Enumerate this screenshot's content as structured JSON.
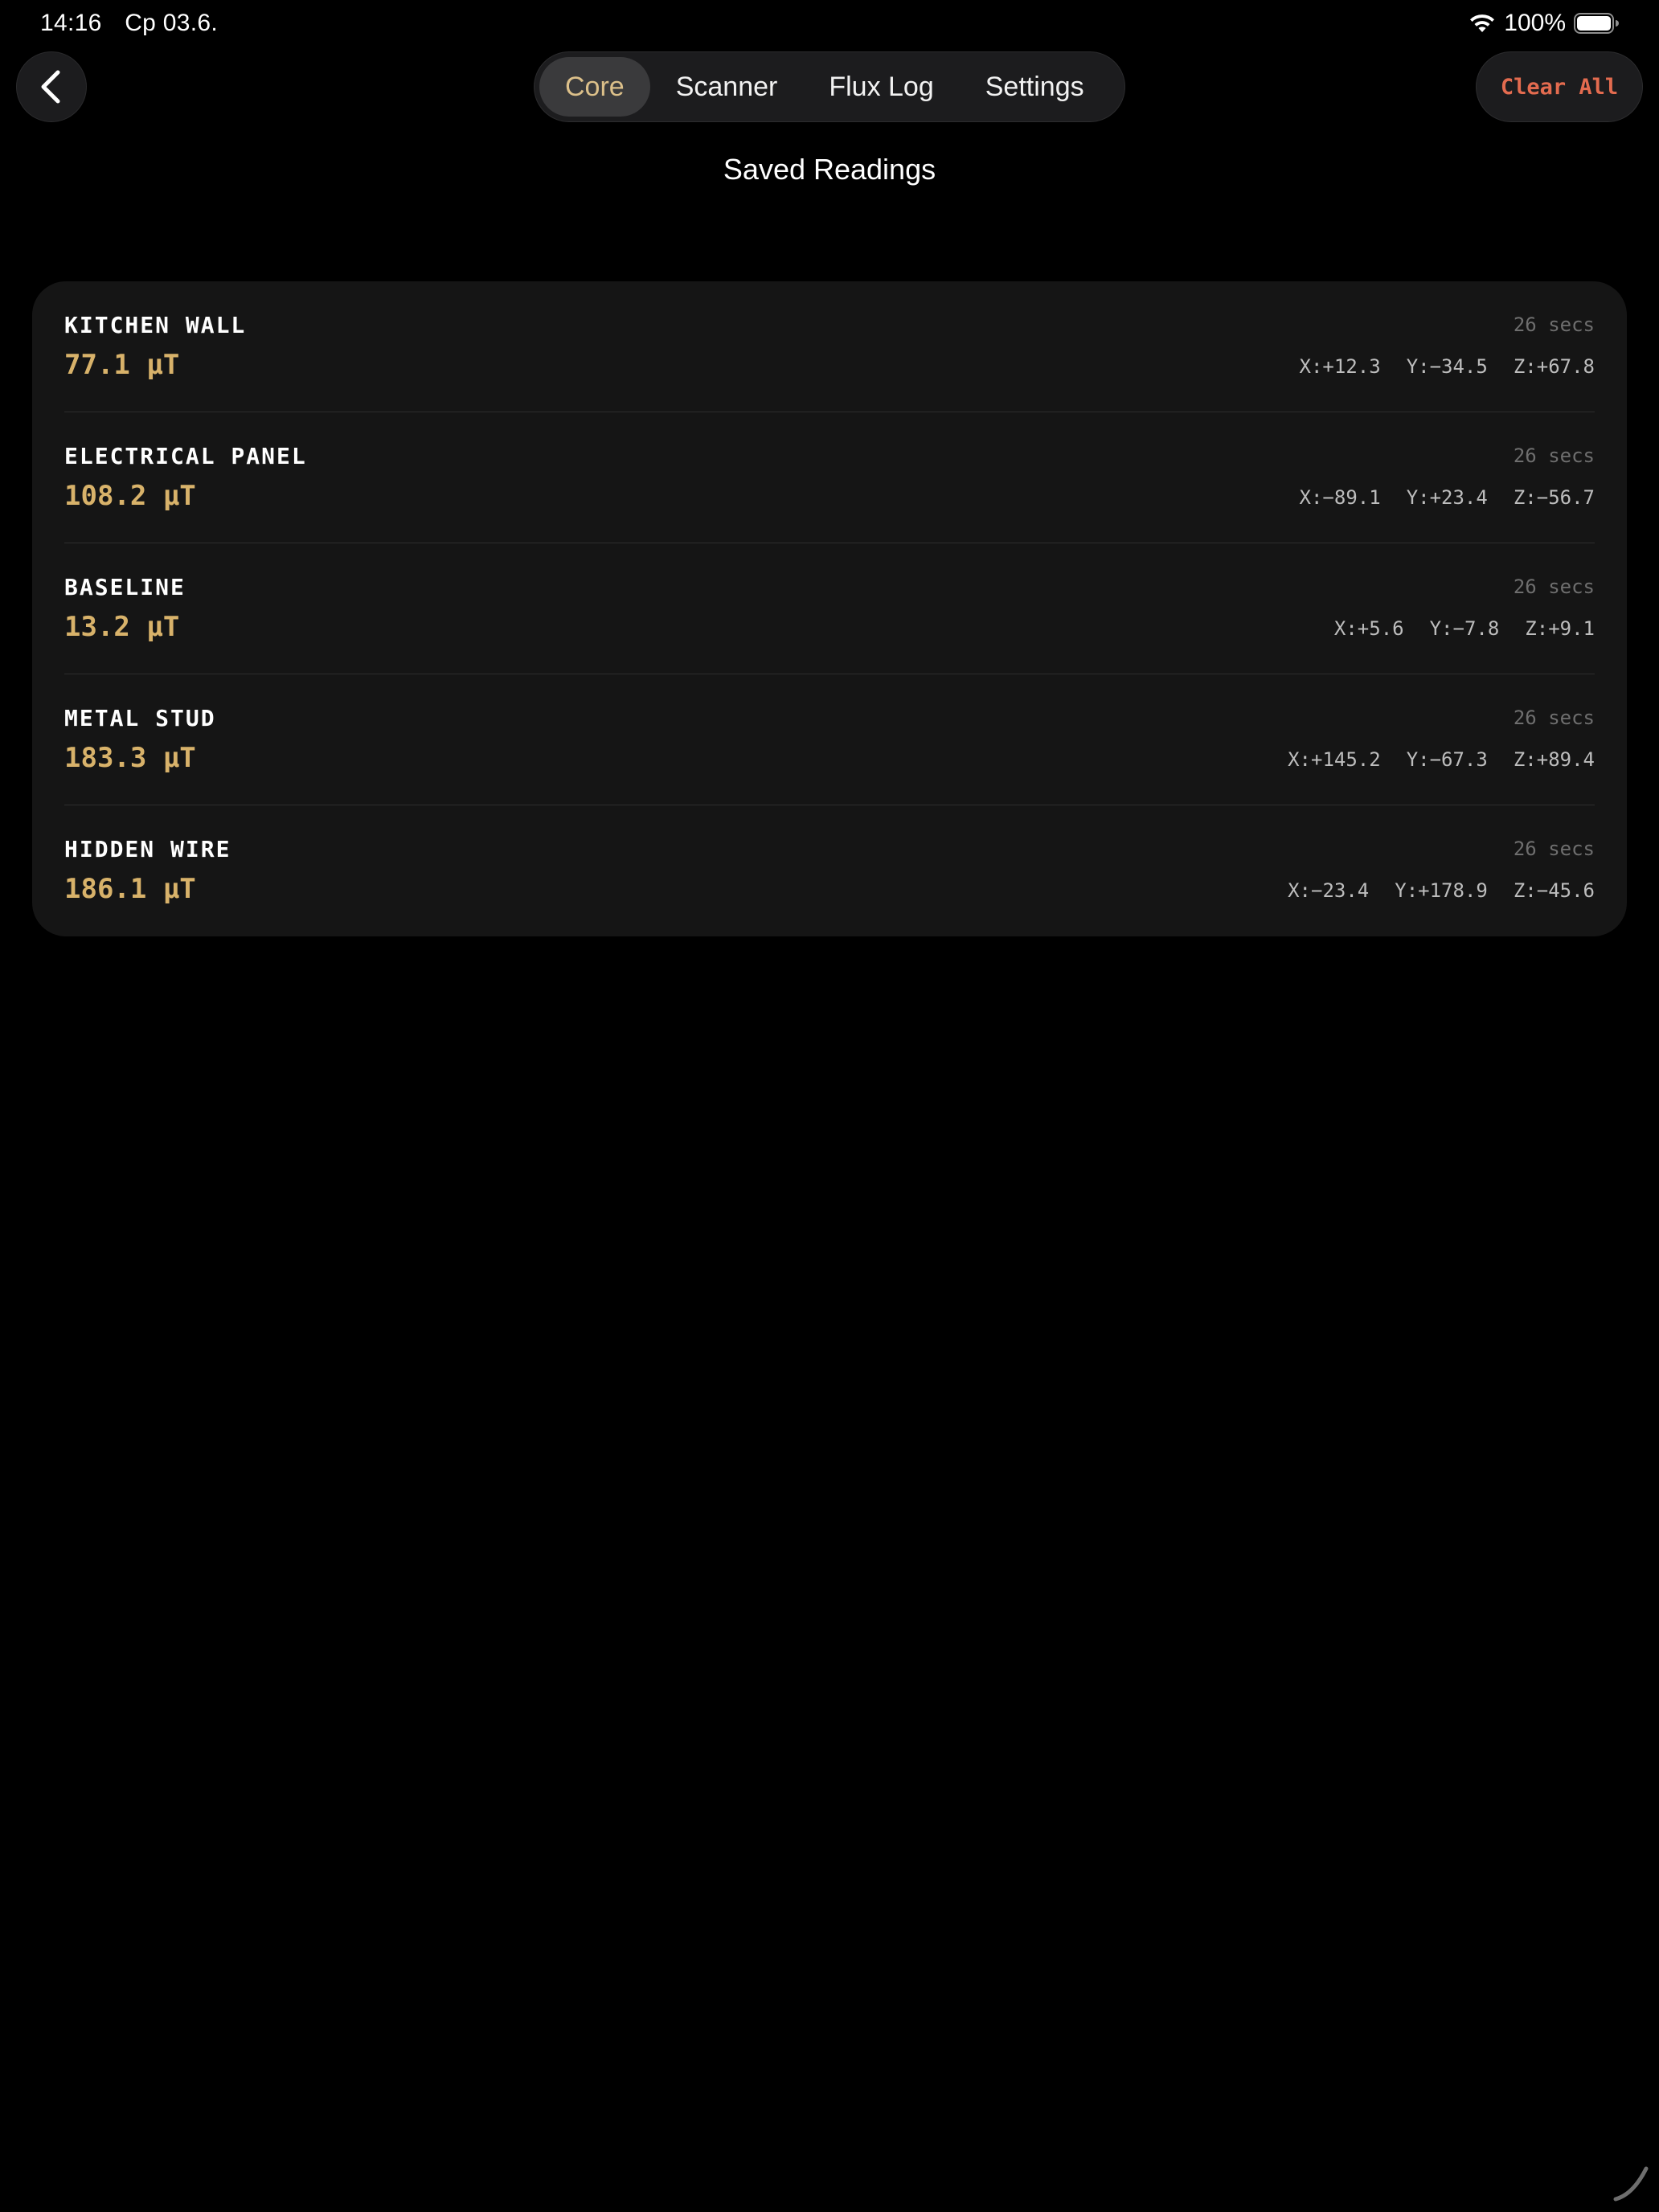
{
  "status_bar": {
    "time": "14:16",
    "date": "Ср 03.6.",
    "battery": "100%"
  },
  "nav": {
    "tabs": [
      {
        "label": "Core",
        "active": true
      },
      {
        "label": "Scanner",
        "active": false
      },
      {
        "label": "Flux Log",
        "active": false
      },
      {
        "label": "Settings",
        "active": false
      }
    ],
    "clear_label": "Clear All"
  },
  "page_title": "Saved Readings",
  "readings": [
    {
      "name": "KITCHEN WALL",
      "time": "26 secs",
      "value": "77.1 µT",
      "x": "X:+12.3",
      "y": "Y:−34.5",
      "z": "Z:+67.8"
    },
    {
      "name": "ELECTRICAL PANEL",
      "time": "26 secs",
      "value": "108.2 µT",
      "x": "X:−89.1",
      "y": "Y:+23.4",
      "z": "Z:−56.7"
    },
    {
      "name": "BASELINE",
      "time": "26 secs",
      "value": "13.2 µT",
      "x": "X:+5.6",
      "y": "Y:−7.8",
      "z": "Z:+9.1"
    },
    {
      "name": "METAL STUD",
      "time": "26 secs",
      "value": "183.3 µT",
      "x": "X:+145.2",
      "y": "Y:−67.3",
      "z": "Z:+89.4"
    },
    {
      "name": "HIDDEN WIRE",
      "time": "26 secs",
      "value": "186.1 µT",
      "x": "X:−23.4",
      "y": "Y:+178.9",
      "z": "Z:−45.6"
    }
  ],
  "colors": {
    "accent": "#d8b26a",
    "destructive": "#e36b4f",
    "card": "#151515"
  }
}
